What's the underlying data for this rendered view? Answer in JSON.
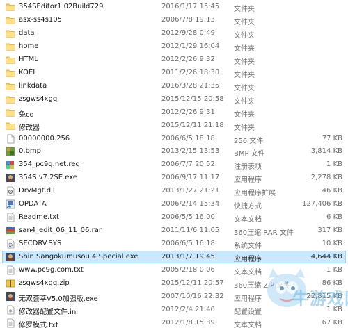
{
  "files": [
    {
      "name": "354SEditor1.02Build729",
      "date": "2016/1/17 15:45",
      "type": "文件夹",
      "size": "",
      "icon": "folder-icon"
    },
    {
      "name": "asx-ss4s105",
      "date": "2006/7/8 19:13",
      "type": "文件夹",
      "size": "",
      "icon": "folder-icon"
    },
    {
      "name": "data",
      "date": "2012/9/28 0:49",
      "type": "文件夹",
      "size": "",
      "icon": "folder-icon"
    },
    {
      "name": "home",
      "date": "2012/1/29 16:04",
      "type": "文件夹",
      "size": "",
      "icon": "folder-icon"
    },
    {
      "name": "HTML",
      "date": "2012/2/26 9:32",
      "type": "文件夹",
      "size": "",
      "icon": "folder-icon"
    },
    {
      "name": "KOEI",
      "date": "2011/2/26 18:30",
      "type": "文件夹",
      "size": "",
      "icon": "folder-icon"
    },
    {
      "name": "linkdata",
      "date": "2016/3/28 21:35",
      "type": "文件夹",
      "size": "",
      "icon": "folder-icon"
    },
    {
      "name": "zsgws4xgq",
      "date": "2015/12/15 20:58",
      "type": "文件夹",
      "size": "",
      "icon": "folder-icon"
    },
    {
      "name": "免cd",
      "date": "2012/2/26 9:31",
      "type": "文件夹",
      "size": "",
      "icon": "folder-icon"
    },
    {
      "name": "修改器",
      "date": "2015/12/11 21:18",
      "type": "文件夹",
      "size": "",
      "icon": "folder-icon"
    },
    {
      "name": "00000000.256",
      "date": "2006/6/5 18:18",
      "type": "256 文件",
      "size": "77 KB",
      "icon": "blank-file-icon"
    },
    {
      "name": "0.bmp",
      "date": "2013/2/15 13:53",
      "type": "BMP 文件",
      "size": "3,814 KB",
      "icon": "bmp-image-icon"
    },
    {
      "name": "354_pc9g.net.reg",
      "date": "2006/7/7 20:52",
      "type": "注册表项",
      "size": "1 KB",
      "icon": "registry-file-icon"
    },
    {
      "name": "354S v7.2SE.exe",
      "date": "2006/9/17 11:17",
      "type": "应用程序",
      "size": "2,278 KB",
      "icon": "exe-app-icon"
    },
    {
      "name": "DrvMgt.dll",
      "date": "2013/1/27 21:21",
      "type": "应用程序扩展",
      "size": "46 KB",
      "icon": "dll-file-icon"
    },
    {
      "name": "OPDATA",
      "date": "2006/2/14 15:34",
      "type": "快捷方式",
      "size": "127,406 KB",
      "icon": "shortcut-icon"
    },
    {
      "name": "Readme.txt",
      "date": "2006/5/5 16:00",
      "type": "文本文档",
      "size": "6 KB",
      "icon": "text-file-icon"
    },
    {
      "name": "san4_edit_06_11_06.rar",
      "date": "2011/11/6 11:05",
      "type": "360压缩 RAR 文件",
      "size": "317 KB",
      "icon": "rar-archive-icon"
    },
    {
      "name": "SECDRV.SYS",
      "date": "2006/6/5 16:18",
      "type": "系统文件",
      "size": "10 KB",
      "icon": "system-file-icon"
    },
    {
      "name": "Shin Sangokumusou 4 Special.exe",
      "date": "2013/1/7 19:45",
      "type": "应用程序",
      "size": "4,644 KB",
      "icon": "exe-app-icon",
      "selected": true
    },
    {
      "name": "www.pc9g.com.txt",
      "date": "2005/2/18 0:06",
      "type": "文本文档",
      "size": "1 KB",
      "icon": "text-file-icon"
    },
    {
      "name": "zsgws4xgq.zip",
      "date": "2015/12/11 20:57",
      "type": "360压缩 ZIP 文件",
      "size": "86 KB",
      "icon": "zip-archive-icon"
    },
    {
      "name": "无双荟萃V5.0加强版.exe",
      "date": "2007/10/16 22:32",
      "type": "应用程序",
      "size": "22,815 KB",
      "icon": "exe-app-icon"
    },
    {
      "name": "修改器配置文件.ini",
      "date": "2012/2/4 21:40",
      "type": "配置设置",
      "size": "1 KB",
      "icon": "ini-config-icon"
    },
    {
      "name": "修罗模式.txt",
      "date": "2012/1/8 15:39",
      "type": "文本文档",
      "size": "67 KB",
      "icon": "text-file-icon"
    }
  ],
  "watermark": {
    "text": "牛游戏网"
  }
}
